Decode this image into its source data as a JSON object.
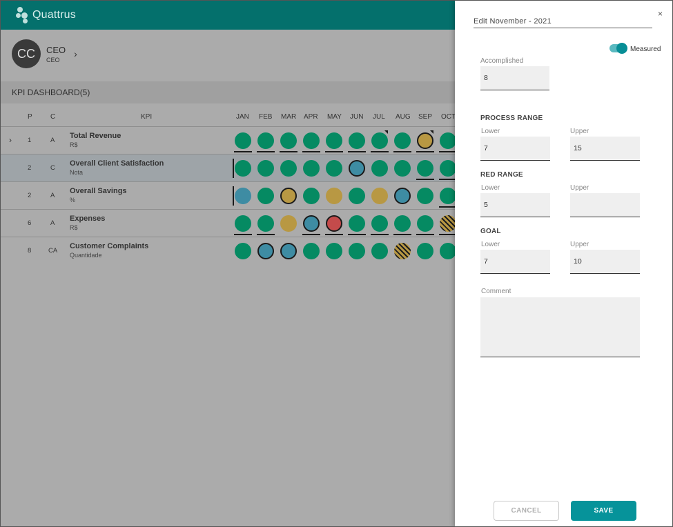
{
  "app": {
    "brand": "Quattrus"
  },
  "user": {
    "initials": "CC",
    "name": "CEO",
    "role": "CEO",
    "chevron": "›"
  },
  "dashboard": {
    "title": "KPI DASHBOARD(5)",
    "columns": {
      "p": "P",
      "c": "C",
      "kpi": "KPI"
    },
    "months": [
      "JAN",
      "FEB",
      "MAR",
      "APR",
      "MAY",
      "JUN",
      "JUL",
      "AUG",
      "SEP",
      "OCT"
    ],
    "rows": [
      {
        "p": "1",
        "c": "A",
        "name": "Total Revenue",
        "unit": "R$",
        "expand_icon": "›"
      },
      {
        "p": "2",
        "c": "C",
        "name": "Overall Client Satisfaction",
        "unit": "Nota"
      },
      {
        "p": "2",
        "c": "A",
        "name": "Overall Savings",
        "unit": "%"
      },
      {
        "p": "6",
        "c": "A",
        "name": "Expenses",
        "unit": "R$"
      },
      {
        "p": "8",
        "c": "CA",
        "name": "Customer Complaints",
        "unit": "Quantidade"
      }
    ],
    "status_grid": [
      [
        "green-u",
        "green-u",
        "green-u",
        "green-u",
        "green-u",
        "green-u",
        "green-uf",
        "green-u",
        "gold-ring-uf",
        "green-u"
      ],
      [
        "green-v",
        "green",
        "green",
        "green",
        "green",
        "blue-ring",
        "green",
        "green",
        "green-u",
        "green-u"
      ],
      [
        "blue-v",
        "green",
        "gold-ring",
        "green",
        "gold",
        "green",
        "gold",
        "blue-ring",
        "green",
        "green-u"
      ],
      [
        "green-u",
        "green-u",
        "gold",
        "blue-ring-u",
        "red-ring-u",
        "green-u",
        "green-u",
        "green-u",
        "green-u",
        "striped-u"
      ],
      [
        "green",
        "blue-ring",
        "blue-ring",
        "green",
        "green",
        "green",
        "green",
        "striped",
        "green",
        "green"
      ]
    ],
    "status_colors": {
      "green": "#058a62",
      "blue": "#3e8ca3",
      "gold": "#b89843",
      "red": "#c44b4b"
    }
  },
  "editor": {
    "close": "×",
    "title": "Edit November - 2021",
    "measured_label": "Measured",
    "measured_on": true,
    "accomplished_label": "Accomplished",
    "accomplished_value": "8",
    "process_range": {
      "title": "PROCESS RANGE",
      "lower_label": "Lower",
      "upper_label": "Upper",
      "lower": "7",
      "upper": "15"
    },
    "red_range": {
      "title": "RED RANGE",
      "lower_label": "Lower",
      "upper_label": "Upper",
      "lower": "5",
      "upper": ""
    },
    "goal": {
      "title": "GOAL",
      "lower_label": "Lower",
      "upper_label": "Upper",
      "lower": "7",
      "upper": "10"
    },
    "comment_label": "Comment",
    "comment_value": "",
    "cancel_label": "CANCEL",
    "save_label": "SAVE"
  }
}
